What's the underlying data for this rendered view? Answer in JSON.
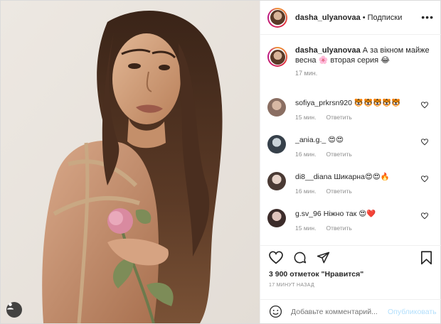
{
  "header": {
    "username": "dasha_ulyanovaa",
    "separator": "•",
    "follow_label": "Подписки",
    "more_label": "•••"
  },
  "caption": {
    "username": "dasha_ulyanovaa",
    "text": "А за вікном майже весна 🌸 вторая серия 😂",
    "time": "17 мин."
  },
  "comments": [
    {
      "username": "sofiya_prkrsn920",
      "text": "🐯🐯🐯🐯🐯",
      "time": "15 мин.",
      "reply": "Ответить"
    },
    {
      "username": "_ania.g._",
      "text": "😍😍",
      "time": "16 мин.",
      "reply": "Ответить"
    },
    {
      "username": "di8__diana",
      "text": "Шикарна😍😍🔥",
      "time": "16 мин.",
      "reply": "Ответить"
    },
    {
      "username": "g.sv_96",
      "text": "Ніжно так 😍❤️",
      "time": "15 мин.",
      "reply": "Ответить"
    }
  ],
  "actions": {
    "likes_text": "3 900 отметок \"Нравится\"",
    "time_ago": "17 МИНУТ НАЗАД",
    "icons": [
      "heart-icon",
      "comment-icon",
      "share-icon",
      "bookmark-icon"
    ]
  },
  "add_comment": {
    "placeholder": "Добавьте комментарий...",
    "publish_label": "Опубликовать"
  },
  "colors": {
    "text": "#262626",
    "muted": "#8e8e8e",
    "publish_disabled": "#b2dffc",
    "border": "#efefef"
  }
}
